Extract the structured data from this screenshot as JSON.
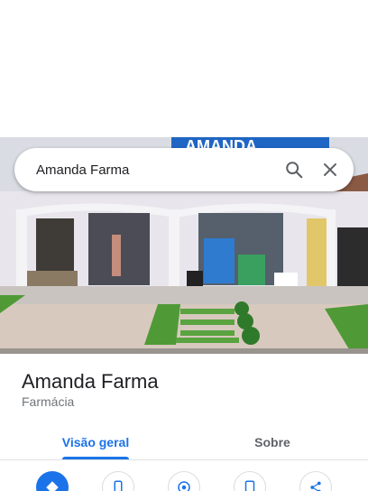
{
  "search": {
    "value": "Amanda Farma"
  },
  "photo": {
    "sign_text": "AMANDA"
  },
  "place": {
    "name": "Amanda Farma",
    "category": "Farmácia"
  },
  "tabs": [
    {
      "label": "Visão geral",
      "selected": true
    },
    {
      "label": "Sobre",
      "selected": false
    }
  ],
  "actions": [
    {
      "icon": "directions-icon",
      "primary": true
    },
    {
      "icon": "phone-icon"
    },
    {
      "icon": "location-icon"
    },
    {
      "icon": "save-icon"
    },
    {
      "icon": "share-icon"
    }
  ],
  "colors": {
    "accent": "#1a73e8",
    "text": "#202124",
    "secondary": "#70757a"
  }
}
